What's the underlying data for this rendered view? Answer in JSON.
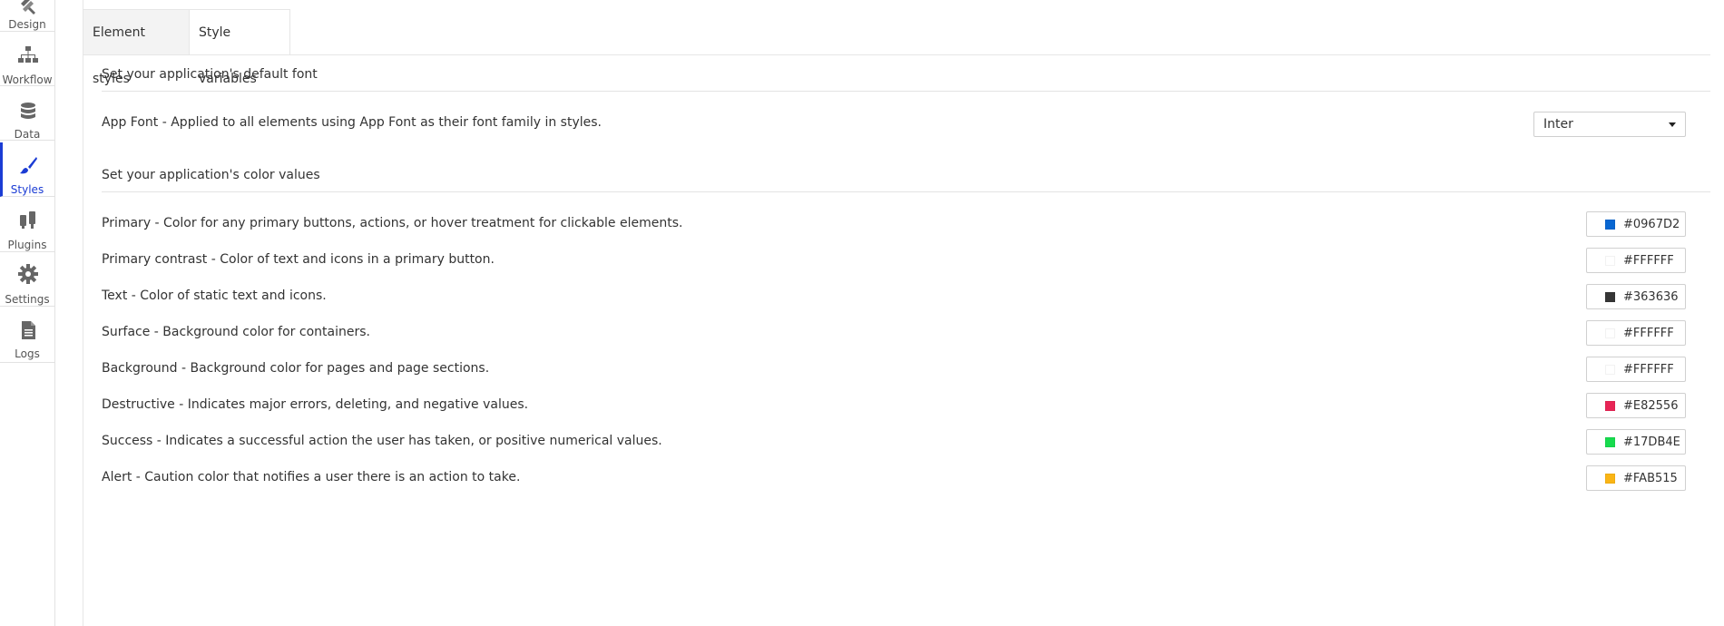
{
  "sidebar": {
    "items": [
      {
        "label": "Design",
        "icon": "design-icon"
      },
      {
        "label": "Workflow",
        "icon": "workflow-icon"
      },
      {
        "label": "Data",
        "icon": "database-icon"
      },
      {
        "label": "Styles",
        "icon": "brush-icon",
        "active": true
      },
      {
        "label": "Plugins",
        "icon": "plug-icon"
      },
      {
        "label": "Settings",
        "icon": "gear-icon"
      },
      {
        "label": "Logs",
        "icon": "document-icon"
      }
    ]
  },
  "tabs": [
    {
      "label": "Element styles"
    },
    {
      "label": "Style variables",
      "active": true
    }
  ],
  "font_section": {
    "title": "Set your application's default font",
    "app_font_label": "App Font - Applied to all elements using App Font as their font family in styles.",
    "selected_font": "Inter"
  },
  "color_section": {
    "title": "Set your application's color values",
    "rows": [
      {
        "label": "Primary - Color for any primary buttons, actions, or hover treatment for clickable elements.",
        "hex": "#0967D2",
        "color": "#0967D2"
      },
      {
        "label": "Primary contrast - Color of text and icons in a primary button.",
        "hex": "#FFFFFF",
        "color": "#FFFFFF"
      },
      {
        "label": "Text - Color of static text and icons.",
        "hex": "#363636",
        "color": "#363636"
      },
      {
        "label": "Surface - Background color for containers.",
        "hex": "#FFFFFF",
        "color": "#FFFFFF"
      },
      {
        "label": "Background - Background color for pages and page sections.",
        "hex": "#FFFFFF",
        "color": "#FFFFFF"
      },
      {
        "label": "Destructive - Indicates major errors, deleting, and negative values.",
        "hex": "#E82556",
        "color": "#E82556"
      },
      {
        "label": "Success - Indicates a successful action the user has taken, or positive numerical values.",
        "hex": "#17DB4E",
        "color": "#17DB4E"
      },
      {
        "label": "Alert - Caution color that notifies a user there is an action to take.",
        "hex": "#FAB515",
        "color": "#FAB515"
      }
    ]
  },
  "colors": {
    "accent": "#1B3CD4",
    "icon_gray": "#666666"
  }
}
